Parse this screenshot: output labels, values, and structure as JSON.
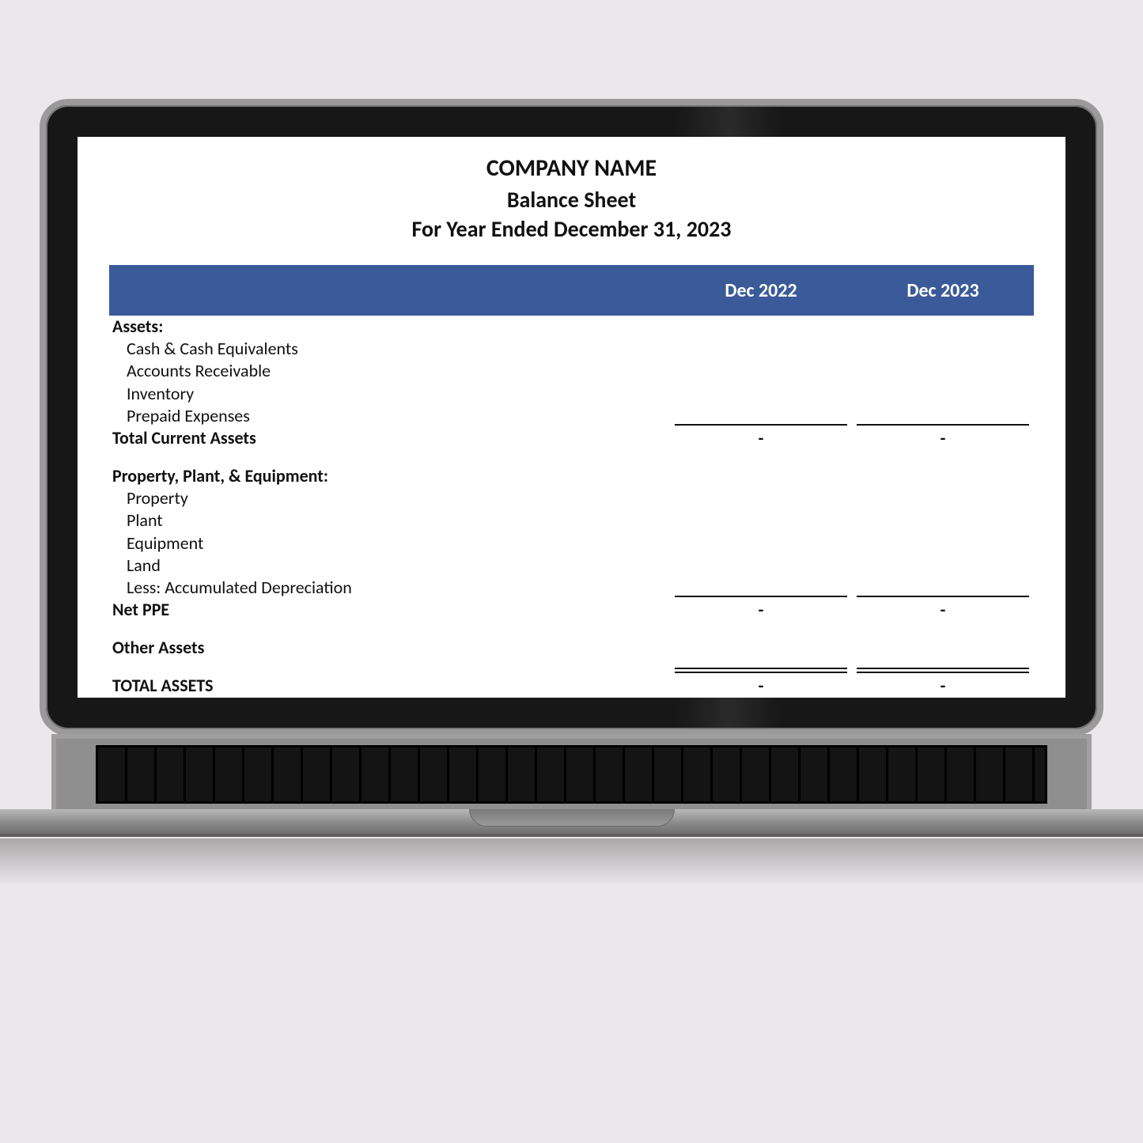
{
  "header": {
    "company": "COMPANY NAME",
    "report": "Balance Sheet",
    "period": "For Year Ended December 31, 2023"
  },
  "columns": {
    "col1": "Dec 2022",
    "col2": "Dec 2023"
  },
  "sections": {
    "assets": {
      "title": "Assets:",
      "lines": [
        "Cash & Cash Equivalents",
        "Accounts Receivable",
        "Inventory",
        "Prepaid Expenses"
      ],
      "total_label": "Total Current Assets",
      "total": {
        "col1": "-",
        "col2": "-"
      }
    },
    "ppe": {
      "title": "Property, Plant, & Equipment:",
      "lines": [
        "Property",
        "Plant",
        "Equipment",
        "Land",
        "Less:  Accumulated Depreciation"
      ],
      "total_label": "Net PPE",
      "total": {
        "col1": "-",
        "col2": "-"
      }
    },
    "other": {
      "title": "Other Assets"
    },
    "grand": {
      "label": "TOTAL ASSETS",
      "total": {
        "col1": "-",
        "col2": "-"
      }
    }
  }
}
